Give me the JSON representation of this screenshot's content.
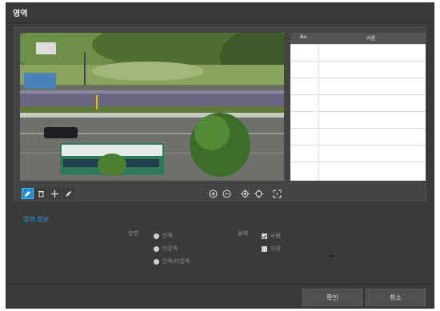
{
  "dialog": {
    "title": "영역"
  },
  "grid": {
    "col_no": "No.",
    "col_name": "이름",
    "rows": 8
  },
  "toolbar": {
    "tools": [
      "draw-icon",
      "delete-icon",
      "move-icon",
      "clear-icon"
    ],
    "zoom": [
      "zoom-in-icon",
      "zoom-out-icon",
      "zoom-fit-icon",
      "zoom-reset-icon",
      "fullscreen-icon"
    ]
  },
  "info": {
    "section_title": "영역 정보",
    "direction_label": "방향",
    "direction_options": [
      "안쪽",
      "바깥쪽",
      "안쪽/바깥쪽"
    ],
    "object_label": "물체",
    "object_options": [
      "사람",
      "차량"
    ],
    "object_checked": [
      true,
      false
    ]
  },
  "buttons": {
    "ok": "확인",
    "cancel": "취소"
  },
  "colors": {
    "accent": "#2aa3e2",
    "active_tool": "#1e8fd6",
    "dialog_bg": "#3a3a3a"
  }
}
